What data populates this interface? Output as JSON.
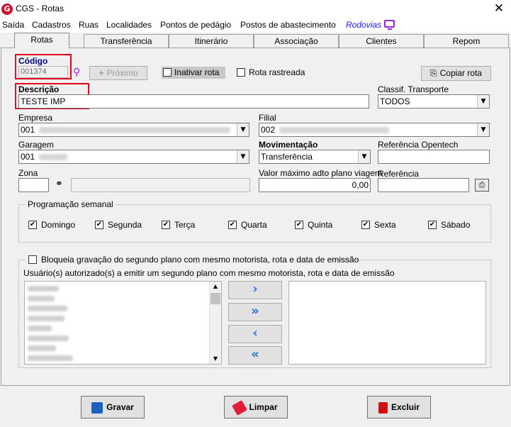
{
  "window": {
    "title": "CGS - Rotas",
    "logo_text": "G",
    "close": "✕"
  },
  "menu": [
    "Saída",
    "Cadastros",
    "Ruas",
    "Localidades",
    "Pontos de pedágio",
    "Postos de abastecimento",
    "Rodovias"
  ],
  "tabs": [
    "Rotas",
    "Transferência",
    "Itinerário",
    "Associação",
    "Clientes",
    "Repom"
  ],
  "codigo": {
    "label": "Código",
    "value": "001374"
  },
  "proximo_label": "Próximo",
  "inativar_label": "Inativar rota",
  "rastreada_label": "Rota rastreada",
  "copiar_label": "Copiar rota",
  "descricao": {
    "label": "Descrição",
    "value": "TESTE IMP"
  },
  "classif": {
    "label": "Classif. Transporte",
    "value": "TODOS"
  },
  "empresa": {
    "label": "Empresa",
    "value": "001"
  },
  "filial": {
    "label": "Filial",
    "value": "002"
  },
  "garagem": {
    "label": "Garagem",
    "value": "001"
  },
  "movimentacao": {
    "label": "Movimentação",
    "value": "Transferência"
  },
  "ref_opentech": {
    "label": "Referência Opentech",
    "value": ""
  },
  "zona": {
    "label": "Zona",
    "value": ""
  },
  "valor_max": {
    "label": "Valor máximo adto plano viagem",
    "value": "0,00"
  },
  "referencia": {
    "label": "Referência",
    "value": ""
  },
  "programacao": {
    "title": "Programação semanal",
    "days": [
      "Domingo",
      "Segunda",
      "Terça",
      "Quarta",
      "Quinta",
      "Sexta",
      "Sábado"
    ],
    "check_glyph": "✔"
  },
  "bloqueia_label": "Bloqueia gravação do segundo plano com mesmo motorista, rota e data de emissão",
  "usuarios_label": "Usuário(s) autorizado(s) a emitir um segundo plano com mesmo motorista, rota e data de emissão",
  "arrows": [
    "›",
    "»",
    "‹",
    "«"
  ],
  "buttons": {
    "gravar": "Gravar",
    "limpar": "Limpar",
    "excluir": "Excluir"
  },
  "colors": {
    "accent_red": "#e0001b",
    "arrow_blue": "#2370d8",
    "rodovias_blue": "#1a1aff"
  }
}
